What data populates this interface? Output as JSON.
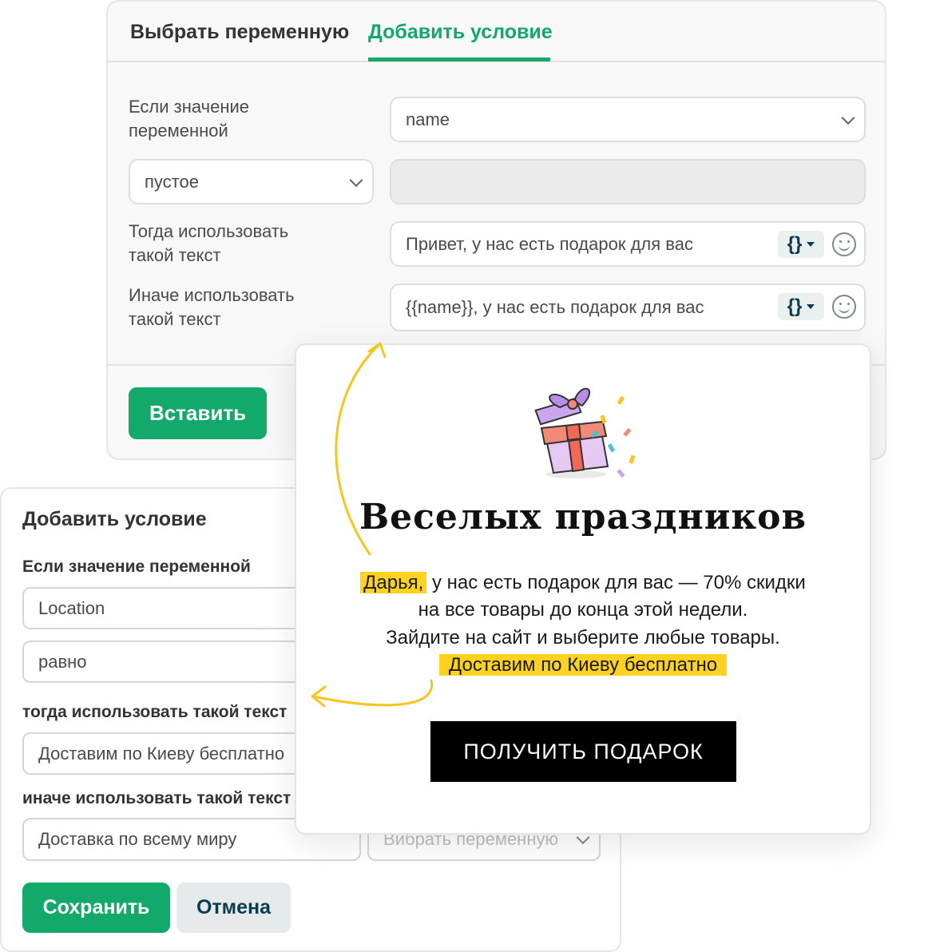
{
  "editor": {
    "tabs": [
      {
        "label": "Выбрать переменную"
      },
      {
        "label": "Добавить условие"
      }
    ],
    "if_label": "Если значение переменной",
    "variable_value": "name",
    "condition_value": "пустое",
    "then_label": "Тогда использовать такой текст",
    "then_text": "Привет, у нас есть подарок для вас",
    "else_label": "Иначе использовать такой текст",
    "else_text": "{{name}}, у нас есть подарок для вас",
    "var_button_label": "{}",
    "insert_button": "Вставить"
  },
  "condition_panel": {
    "title": "Добавить условие",
    "if_label": "Если значение переменной",
    "variable_value": "Location",
    "condition_value": "равно",
    "then_label": "тогда использовать такой текст",
    "then_text": "Доставим по Киеву бесплатно",
    "else_label": "иначе использовать такой текст",
    "else_text": "Доставка по всему миру",
    "select_variable_placeholder": "Вибрать переменную",
    "save_button": "Сохранить",
    "cancel_button": "Отмена"
  },
  "popup": {
    "title": "Веселых праздников",
    "highlight_name": "Дарья,",
    "line1_rest": " у нас есть подарок для вас — 70% скидки",
    "line2": "на все товары до конца этой недели.",
    "line3": "Зайдите на сайт и выберите любые товары.",
    "line4_highlight": "Доставим по Киеву бесплатно",
    "cta": "ПОЛУЧИТЬ ПОДАРОК"
  },
  "colors": {
    "accent": "#12a96a",
    "highlight": "#ffd21f",
    "arrow": "#f7c51e",
    "cta_bg": "#000000"
  }
}
